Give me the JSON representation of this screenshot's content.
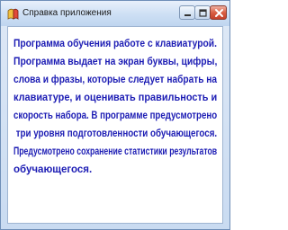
{
  "window": {
    "title": "Справка приложения"
  },
  "icons": {
    "app": "app-icon",
    "minimize": "minimize-icon",
    "maximize": "maximize-icon",
    "close": "close-icon"
  },
  "colors": {
    "text": "#1c1cb4",
    "close_button": "#d95f43"
  },
  "help": {
    "lines": [
      "Программа обучения работе с клавиатурой.",
      "Программа выдает на экран буквы, цифры,",
      "слова и фразы, которые следует набрать на",
      "клавиатуре, и оценивать правильность и",
      "скорость набора. В программе предусмотрено",
      " три уровня подготовленности обучающегося.",
      "Предусмотрено сохранение статистики результатов",
      "обучающегося."
    ]
  }
}
